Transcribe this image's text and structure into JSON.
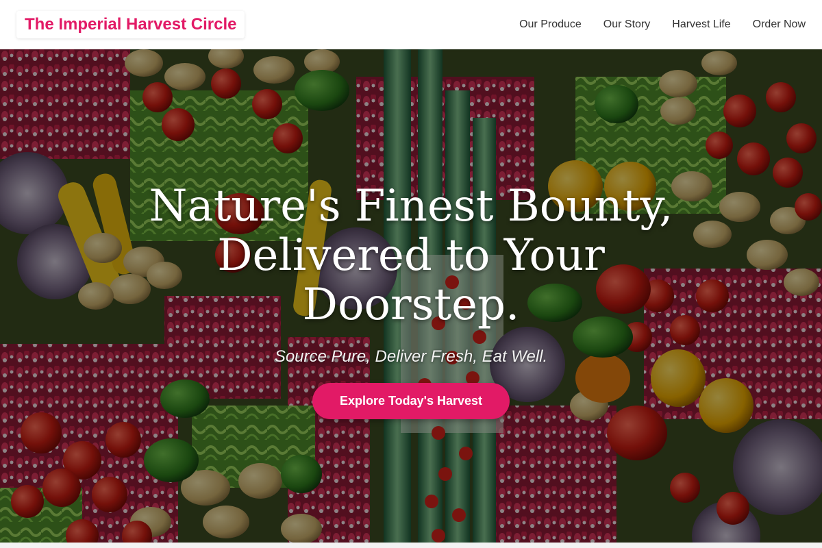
{
  "header": {
    "logo": "The Imperial Harvest Circle",
    "nav": [
      {
        "label": "Our Produce"
      },
      {
        "label": "Our Story"
      },
      {
        "label": "Harvest Life"
      },
      {
        "label": "Order Now"
      }
    ]
  },
  "hero": {
    "title": "Nature's Finest Bounty, Delivered to Your Doorstep.",
    "subtitle": "Source Pure, Deliver Fresh, Eat Well.",
    "cta_label": "Explore Today's Harvest",
    "background_image": "assorted-vegetables-photo"
  },
  "colors": {
    "accent": "#e21a66",
    "text_dark": "#333333",
    "header_bg": "#ffffff"
  }
}
